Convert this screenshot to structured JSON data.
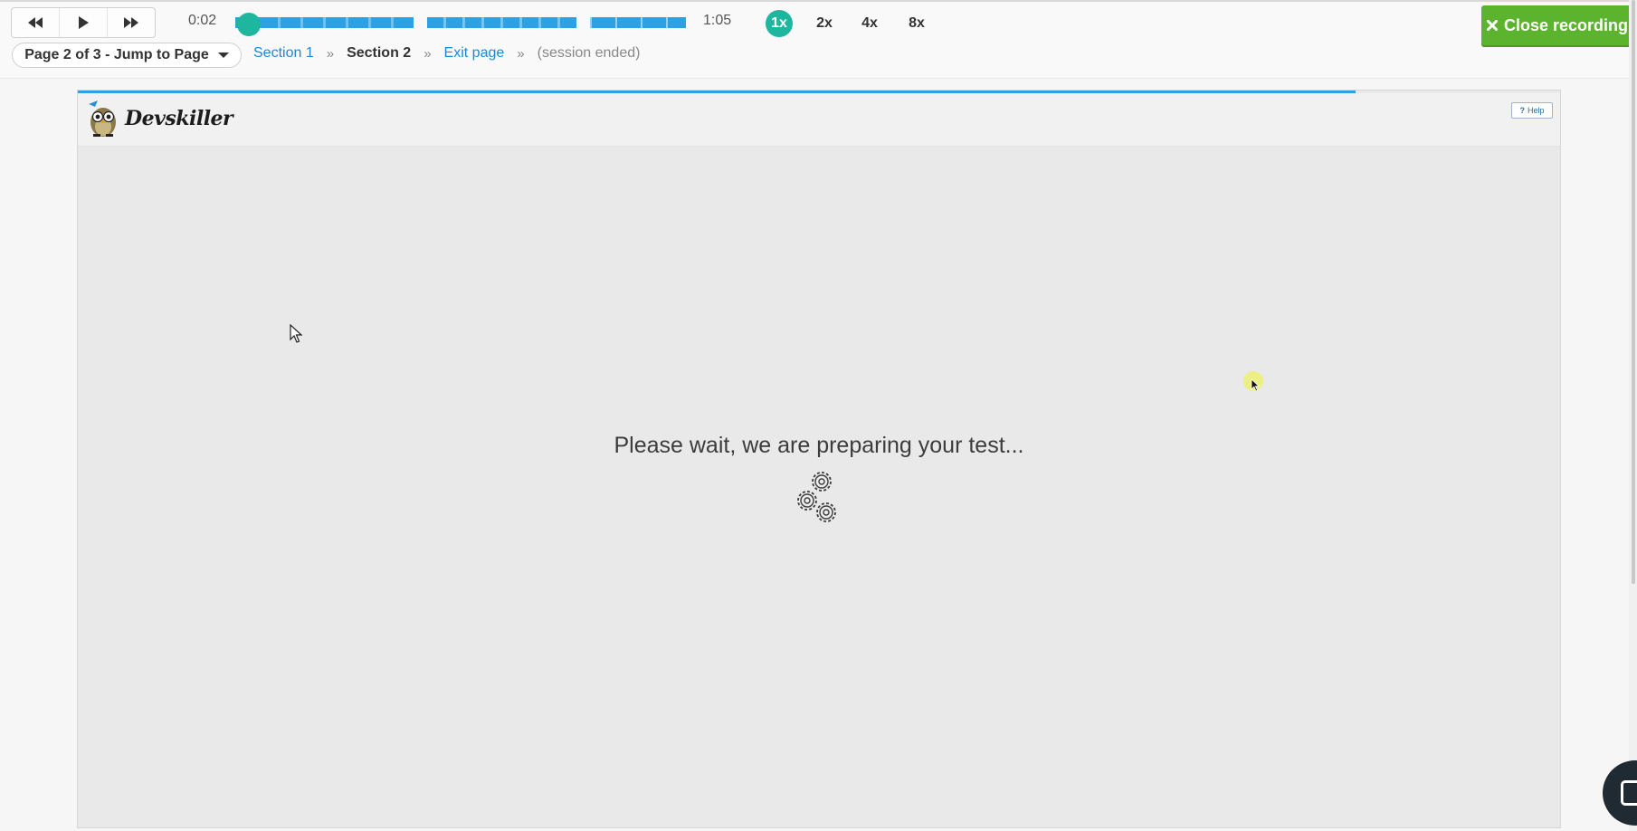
{
  "player": {
    "current_time": "0:02",
    "total_time": "1:05",
    "progress_fraction": 0.03,
    "speeds": [
      {
        "label": "1x",
        "active": true
      },
      {
        "label": "2x",
        "active": false
      },
      {
        "label": "4x",
        "active": false
      },
      {
        "label": "8x",
        "active": false
      }
    ],
    "close_label": "Close recording",
    "icons": [
      "rewind-icon",
      "play-icon",
      "fast-forward-icon",
      "close-x-icon"
    ]
  },
  "navigation": {
    "page_jump_label": "Page 2 of 3 - Jump to Page",
    "breadcrumbs": [
      {
        "label": "Section 1",
        "type": "link"
      },
      {
        "label": "Section 2",
        "type": "current"
      },
      {
        "label": "Exit page",
        "type": "link"
      },
      {
        "label": "(session ended)",
        "type": "status"
      }
    ],
    "separator": "»"
  },
  "recording": {
    "brand": "Devskiller",
    "help_label": "Help",
    "help_icon": "?",
    "loading_message": "Please wait, we are preparing your test...",
    "icons": [
      "devskiller-owl-logo",
      "gears-loading-icon",
      "mouse-pointer-icon",
      "click-highlight"
    ]
  },
  "colors": {
    "accent_teal": "#1fb6a0",
    "progress_blue": "#2ba1e6",
    "close_green": "#5cb32d",
    "link_blue": "#1a8ad3"
  }
}
